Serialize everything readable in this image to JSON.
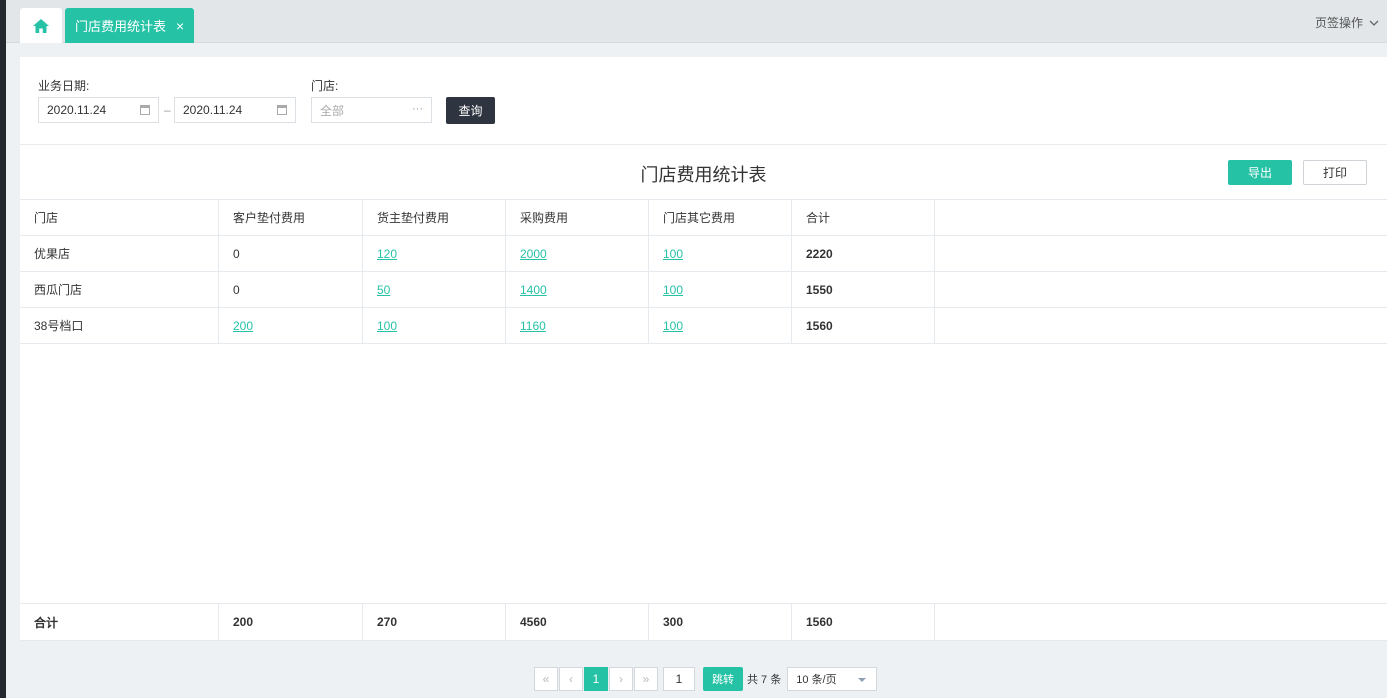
{
  "tabs": {
    "home_icon": "home-icon",
    "active_label": "门店费用统计表",
    "close_glyph": "×",
    "ops_label": "页签操作"
  },
  "filter": {
    "date_label": "业务日期:",
    "date_start": "2020.11.24",
    "date_end": "2020.11.24",
    "date_sep": "–",
    "store_label": "门店:",
    "store_placeholder": "全部",
    "store_suffix": "···",
    "query_button": "查询"
  },
  "report": {
    "title": "门店费用统计表",
    "export_button": "导出",
    "print_button": "打印"
  },
  "table": {
    "headers": [
      "门店",
      "客户垫付费用",
      "货主垫付费用",
      "采购费用",
      "门店其它费用",
      "合计"
    ],
    "rows": [
      [
        "优果店",
        "0",
        "120",
        "2000",
        "100",
        "2220"
      ],
      [
        "西瓜门店",
        "0",
        "50",
        "1400",
        "100",
        "1550"
      ],
      [
        "38号档口",
        "200",
        "100",
        "1160",
        "100",
        "1560"
      ]
    ],
    "totals": [
      "合计",
      "200",
      "270",
      "4560",
      "300",
      "1560"
    ]
  },
  "pager": {
    "first": "«",
    "prev": "‹",
    "current": "1",
    "next": "›",
    "last": "»",
    "jump_value": "1",
    "jump_button": "跳转",
    "total_text": "共 7 条",
    "page_size": "10 条/页"
  },
  "colors": {
    "accent": "#26c2a6",
    "dark_button": "#2f3540"
  }
}
